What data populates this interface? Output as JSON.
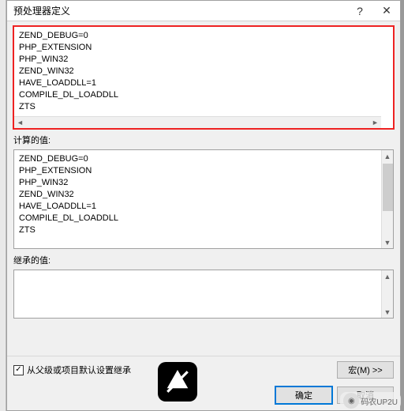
{
  "dialog": {
    "title": "预处理器定义",
    "help": "?",
    "close": "✕"
  },
  "defs_text": "ZEND_DEBUG=0\nPHP_EXTENSION\nPHP_WIN32\nZEND_WIN32\nHAVE_LOADDLL=1\nCOMPILE_DL_LOADDLL\nZTS",
  "labels": {
    "calc": "计算的值:",
    "inherit": "继承的值:"
  },
  "calc_text": "ZEND_DEBUG=0\nPHP_EXTENSION\nPHP_WIN32\nZEND_WIN32\nHAVE_LOADDLL=1\nCOMPILE_DL_LOADDLL\nZTS",
  "inherit_text": "",
  "footer": {
    "checkbox_label": "从父级或项目默认设置继承",
    "checkbox_checked": "✓",
    "macro": "宏(M) >>",
    "ok": "确定",
    "cancel": "取消"
  },
  "watermark": "码农UP2U"
}
